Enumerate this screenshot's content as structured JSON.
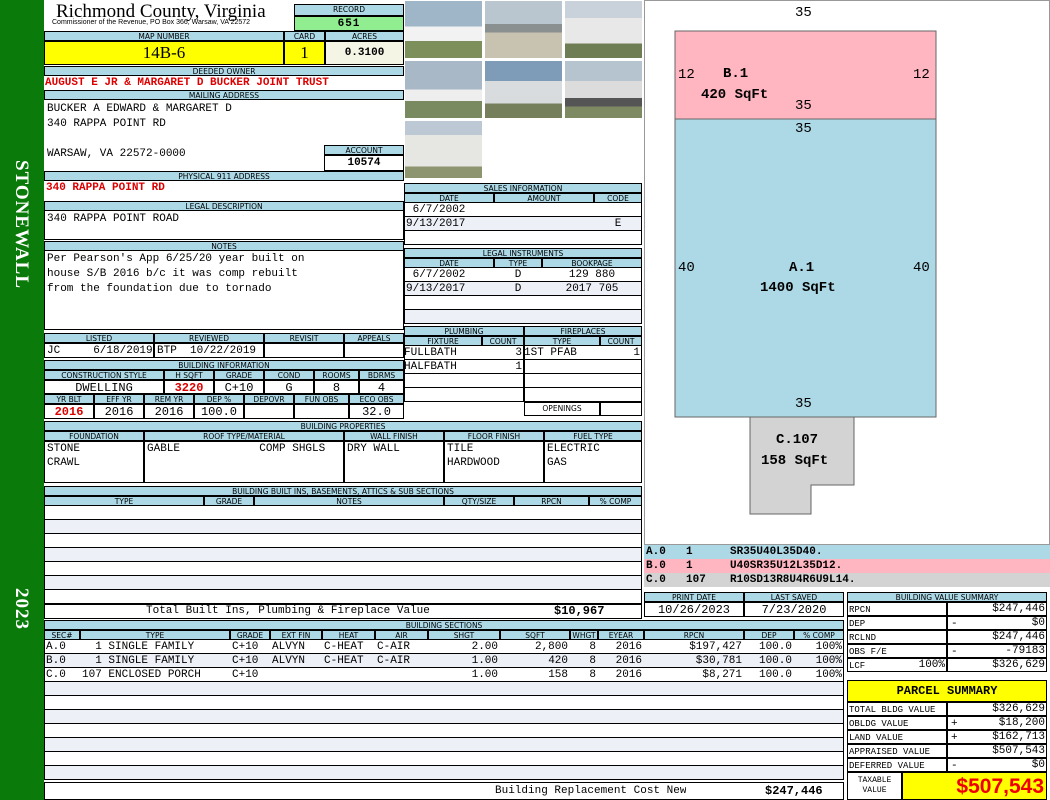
{
  "sidebar": {
    "district": "STONEWALL",
    "year": "2023"
  },
  "header": {
    "title": "Richmond County, Virginia",
    "subtitle": "Commissioner of the Revenue, PO Box 366, Warsaw, VA 22572",
    "record_label": "RECORD",
    "record": "651"
  },
  "parcel": {
    "map_label": "MAP NUMBER",
    "map_number": "14B-6",
    "card_label": "CARD",
    "card": "1",
    "acres_label": "ACRES",
    "acres": "0.3100"
  },
  "owner": {
    "label": "DEEDED OWNER",
    "name": "AUGUST E JR & MARGARET D BUCKER JOINT TRUST"
  },
  "mailing": {
    "label": "MAILING ADDRESS",
    "line1": "BUCKER A EDWARD & MARGARET D",
    "line2": "340 RAPPA POINT RD",
    "line3": "WARSAW, VA 22572-0000",
    "account_label": "ACCOUNT",
    "account": "10574"
  },
  "physical": {
    "label": "PHYSICAL 911 ADDRESS",
    "address": "340 RAPPA POINT RD"
  },
  "legal": {
    "label": "LEGAL DESCRIPTION",
    "text": "340 RAPPA POINT ROAD"
  },
  "notes": {
    "label": "NOTES",
    "lines": [
      "Per Pearson's App 6/25/20 year built on",
      "house S/B 2016 b/c it was comp rebuilt",
      "from the foundation due to tornado"
    ]
  },
  "listing": {
    "headers": [
      "LISTED",
      "REVIEWED",
      "REVISIT",
      "APPEALS"
    ],
    "values": [
      "JC     6/18/2019",
      "BTP  10/22/2019",
      "",
      ""
    ]
  },
  "building_info": {
    "label": "BUILDING INFORMATION",
    "h1": [
      "CONSTRUCTION STYLE",
      "H SQFT",
      "GRADE",
      "COND",
      "ROOMS",
      "BDRMS"
    ],
    "v1": [
      "DWELLING",
      "3220",
      "C+10",
      "G",
      "8",
      "4"
    ],
    "h2": [
      "YR BLT",
      "EFF YR",
      "REM YR",
      "DEP %",
      "DEPOVR",
      "FUN OBS",
      "ECO OBS"
    ],
    "v2": [
      "2016",
      "2016",
      "2016",
      "100.0",
      "",
      "",
      "32.0"
    ]
  },
  "properties": {
    "label": "BUILDING PROPERTIES",
    "headers": [
      "FOUNDATION",
      "ROOF TYPE/MATERIAL",
      "WALL FINISH",
      "FLOOR FINISH",
      "FUEL TYPE"
    ],
    "values": [
      "STONE\nCRAWL",
      "GABLE            COMP SHGLS",
      "DRY WALL",
      "TILE\nHARDWOOD",
      "ELECTRIC\nGAS"
    ]
  },
  "builtins": {
    "label": "BUILDING BUILT INS, BASEMENTS, ATTICS & SUB SECTIONS",
    "headers": [
      "TYPE",
      "GRADE",
      "NOTES",
      "QTY/SIZE",
      "RPCN",
      "% COMP"
    ],
    "total_label": "Total Built Ins, Plumbing & Fireplace Value",
    "total": "$10,967"
  },
  "sections": {
    "label": "BUILDING SECTIONS",
    "headers": [
      "SEC#",
      "TYPE",
      "GRADE",
      "EXT FIN",
      "HEAT",
      "AIR",
      "SHGT",
      "SQFT",
      "WHGT",
      "EYEAR",
      "RPCN",
      "DEP",
      "% COMP"
    ],
    "rows": [
      [
        "A.0",
        "  1 SINGLE FAMILY",
        "C+10",
        "ALVYN",
        "C-HEAT",
        "C-AIR",
        "2.00",
        "2,800",
        "8",
        "2016",
        "$197,427",
        "100.0",
        "100%"
      ],
      [
        "B.0",
        "  1 SINGLE FAMILY",
        "C+10",
        "ALVYN",
        "C-HEAT",
        "C-AIR",
        "1.00",
        "420",
        "8",
        "2016",
        "$30,781",
        "100.0",
        "100%"
      ],
      [
        "C.0",
        "107 ENCLOSED PORCH",
        "C+10",
        "",
        "",
        "",
        "1.00",
        "158",
        "8",
        "2016",
        "$8,271",
        "100.0",
        "100%"
      ]
    ],
    "total_label": "Building Replacement Cost New",
    "total": "$247,446"
  },
  "sales": {
    "label": "SALES INFORMATION",
    "headers": [
      "DATE",
      "AMOUNT",
      "CODE"
    ],
    "rows": [
      [
        " 6/7/2002",
        "",
        ""
      ],
      [
        "9/13/2017",
        "",
        "E"
      ]
    ]
  },
  "instruments": {
    "label": "LEGAL INSTRUMENTS",
    "headers": [
      "DATE",
      "TYPE",
      "BOOKPAGE"
    ],
    "rows": [
      [
        " 6/7/2002",
        "D",
        "129 880"
      ],
      [
        "9/13/2017",
        "D",
        "2017 705"
      ]
    ]
  },
  "plumbing": {
    "label": "PLUMBING",
    "headers": [
      "FIXTURE",
      "COUNT"
    ],
    "rows": [
      [
        "FULLBATH",
        "3"
      ],
      [
        "HALFBATH",
        "1"
      ]
    ]
  },
  "fireplaces": {
    "label": "FIREPLACES",
    "headers": [
      "TYPE",
      "COUNT"
    ],
    "rows": [
      [
        "1ST PFAB",
        "1"
      ]
    ],
    "openings_label": "OPENINGS"
  },
  "sketch": {
    "areas": [
      {
        "id": "B.1",
        "area": "420 SqFt",
        "dims": [
          "35",
          "12",
          "12",
          "35"
        ]
      },
      {
        "id": "A.1",
        "area": "1400 SqFt",
        "dims": [
          "35",
          "40",
          "40",
          "35"
        ]
      },
      {
        "id": "C.107",
        "area": "158 SqFt"
      }
    ],
    "codes": [
      [
        "A.0",
        "1",
        "SR35U40L35D40."
      ],
      [
        "B.0",
        "1",
        "U40SR35U12L35D12."
      ],
      [
        "C.0",
        "107",
        "R10SD13R8U4R6U9L14."
      ]
    ]
  },
  "dates": {
    "print_label": "PRINT DATE",
    "print": "10/26/2023",
    "saved_label": "LAST SAVED",
    "saved": "7/23/2020"
  },
  "value_summary": {
    "label": "BUILDING VALUE SUMMARY",
    "rows": [
      [
        "RPCN",
        "",
        "",
        "$247,446"
      ],
      [
        "DEP",
        "",
        "-",
        "$0"
      ],
      [
        "RCLND",
        "",
        "",
        "$247,446"
      ],
      [
        "OBS F/E",
        "",
        "-",
        "-79183"
      ],
      [
        "LCF",
        "100%",
        "",
        "$326,629"
      ]
    ]
  },
  "parcel_summary": {
    "label": "PARCEL SUMMARY",
    "rows": [
      [
        "TOTAL BLDG VALUE",
        "",
        "$326,629"
      ],
      [
        "OBLDG VALUE",
        "+",
        "$18,200"
      ],
      [
        "LAND VALUE",
        "+",
        "$162,713"
      ],
      [
        "APPRAISED VALUE",
        "",
        "$507,543"
      ],
      [
        "DEFERRED VALUE",
        "-",
        "$0"
      ]
    ],
    "taxable_label": "TAXABLE VALUE",
    "taxable": "$507,543"
  },
  "colors": {
    "header": "#add8e6",
    "green": "#0a7a0a",
    "yellow": "#ffff00",
    "red": "#dd0000",
    "pink": "#ffb6c1",
    "blue": "#add8e6",
    "gray": "#d3d3d3"
  }
}
